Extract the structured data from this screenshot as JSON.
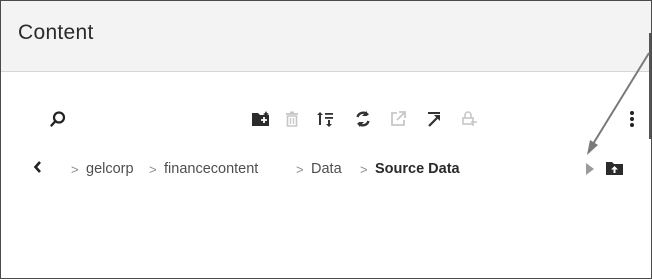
{
  "panel": {
    "title": "Content"
  },
  "toolbar": {
    "icons": [
      {
        "name": "search-icon"
      },
      {
        "name": "new-folder-icon"
      },
      {
        "name": "delete-icon"
      },
      {
        "name": "sort-icon"
      },
      {
        "name": "refresh-icon"
      },
      {
        "name": "open-external-icon"
      },
      {
        "name": "expand-icon"
      },
      {
        "name": "lock-icon"
      },
      {
        "name": "more-vertical-icon"
      }
    ]
  },
  "breadcrumb": {
    "items": [
      {
        "label": "gelcorp"
      },
      {
        "label": "financecontent"
      },
      {
        "label": "Data"
      },
      {
        "label": "Source Data"
      }
    ],
    "separator": ">"
  },
  "colors": {
    "header_bg": "#f3f3f3",
    "text": "#2b2b2b",
    "disabled_icon": "#c7c7c7",
    "annotation_arrow": "#7a7a7a"
  }
}
